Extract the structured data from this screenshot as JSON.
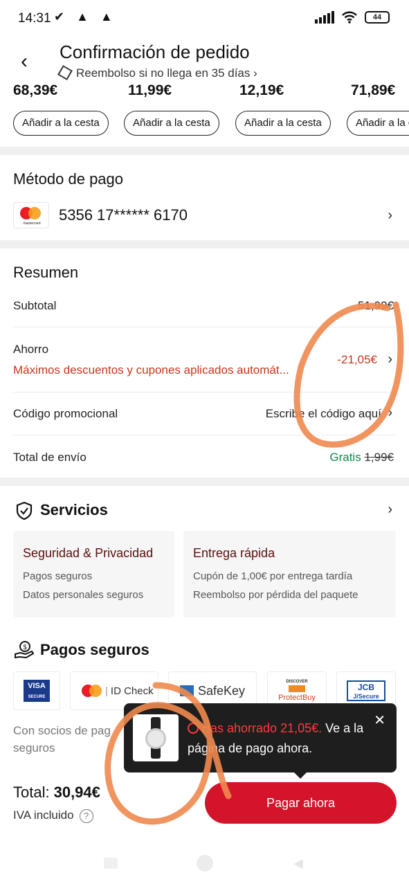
{
  "status_bar": {
    "time": "14:31",
    "left_icons": "✔ ▲ ▲",
    "battery": "44"
  },
  "header": {
    "back_icon": "‹",
    "title": "Confirmación de pedido",
    "subtitle": "Reembolso si no llega en 35 días ›"
  },
  "products": [
    {
      "price": "68,39€",
      "button": "Añadir a la cesta"
    },
    {
      "price": "11,99€",
      "button": "Añadir a la cesta"
    },
    {
      "price": "12,19€",
      "button": "Añadir a la cesta"
    },
    {
      "price": "71,89€",
      "button": "Añadir a la cesta"
    }
  ],
  "payment": {
    "title": "Método de pago",
    "card_brand": "mastercard",
    "card_number": "5356 17****** 6170",
    "chevron": "›"
  },
  "summary": {
    "title": "Resumen",
    "subtotal_label": "Subtotal",
    "subtotal_value": "51,99€",
    "savings_label": "Ahorro",
    "savings_note": "Máximos descuentos y cupones aplicados automát...",
    "savings_value": "-21,05€",
    "promo_label": "Código promocional",
    "promo_value": "Escribe el código aquí",
    "shipping_label": "Total de envío",
    "shipping_free": "Gratis",
    "shipping_old": "1,99€"
  },
  "services": {
    "title": "Servicios",
    "boxes": [
      {
        "title": "Seguridad & Privacidad",
        "items": [
          "Pagos seguros",
          "Datos personales seguros"
        ]
      },
      {
        "title": "Entrega rápida",
        "items": [
          "Cupón de 1,00€ por entrega tardía",
          "Reembolso por pérdida del paquete"
        ]
      }
    ]
  },
  "secure_payments": {
    "title": "Pagos seguros",
    "logos": [
      {
        "name": "visa-secure",
        "line1": "VISA",
        "line2": "SECURE"
      },
      {
        "name": "mastercard-idcheck",
        "label": "ID Check"
      },
      {
        "name": "amex-safekey",
        "label": "SafeKey"
      },
      {
        "name": "discover-protectbuy",
        "line1": "DISCOVER",
        "line2": "ProtectBuy"
      },
      {
        "name": "jcb-jsecure",
        "line1": "JCB",
        "line2": "J/Secure"
      }
    ],
    "partners_text": "Con socios de pag",
    "partners_text2": "seguros"
  },
  "bottom": {
    "total_label": "Total:",
    "total_value": "30,94€",
    "iva": "IVA incluido",
    "pay_button": "Pagar ahora"
  },
  "toast": {
    "highlight": "Has ahorrado 21,05€.",
    "text": " Ve a la página de pago ahora.",
    "close": "✕"
  },
  "colors": {
    "accent": "#d4142b",
    "savings": "#c7361c",
    "free": "#0a8a4a",
    "annotation": "#ef8a4f"
  }
}
